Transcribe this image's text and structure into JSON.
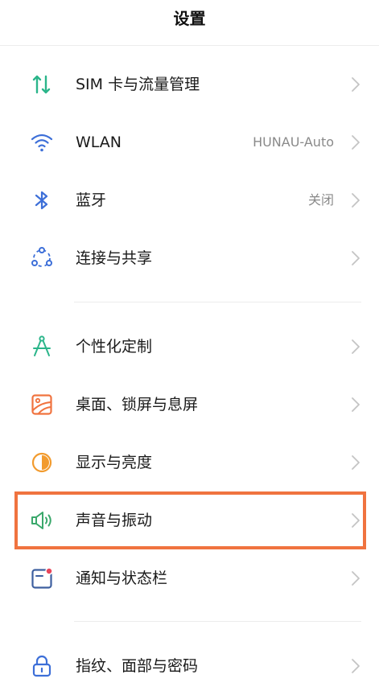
{
  "header": {
    "title": "设置"
  },
  "items": [
    {
      "label": "SIM 卡与流量管理",
      "value": "",
      "icon": "sim-data-icon"
    },
    {
      "label": "WLAN",
      "value": "HUNAU-Auto",
      "icon": "wifi-icon"
    },
    {
      "label": "蓝牙",
      "value": "关闭",
      "icon": "bluetooth-icon"
    },
    {
      "label": "连接与共享",
      "value": "",
      "icon": "connection-share-icon"
    },
    {
      "label": "个性化定制",
      "value": "",
      "icon": "compass-icon"
    },
    {
      "label": "桌面、锁屏与息屏",
      "value": "",
      "icon": "wallpaper-icon"
    },
    {
      "label": "显示与亮度",
      "value": "",
      "icon": "brightness-icon"
    },
    {
      "label": "声音与振动",
      "value": "",
      "icon": "speaker-icon"
    },
    {
      "label": "通知与状态栏",
      "value": "",
      "icon": "notification-icon"
    },
    {
      "label": "指纹、面部与密码",
      "value": "",
      "icon": "lock-icon"
    }
  ],
  "highlighted_item": "声音与振动",
  "colors": {
    "highlight_border": "#f0733f",
    "sim_green": "#2bb58a",
    "wifi_blue": "#3d6fd8",
    "bluetooth_blue": "#3d6fd8",
    "connection_blue": "#3d6fd8",
    "compass_green": "#2bb58a",
    "wallpaper_orange": "#f0733f",
    "brightness_orange": "#f29b2e",
    "speaker_green": "#3aa86b",
    "notification_blue": "#3d5f9f",
    "notification_dot": "#e8455a",
    "lock_blue": "#3d6fd8"
  }
}
